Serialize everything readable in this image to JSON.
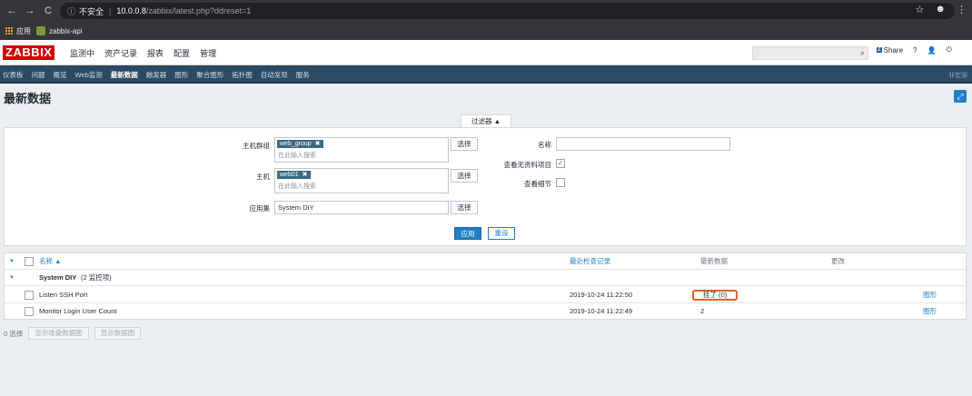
{
  "browser": {
    "nav": {
      "back": "←",
      "forward": "→",
      "reload": "C",
      "info": "ⓘ"
    },
    "security": "不安全",
    "url_host": "10.0.0.8",
    "url_path": "/zabbix/latest.php?ddreset=1",
    "bookmarks": [
      "应用",
      "zabbix-api"
    ]
  },
  "header": {
    "logo": "ZABBIX",
    "menu": [
      "监测中",
      "资产记录",
      "报表",
      "配置",
      "管理"
    ],
    "share": "Share",
    "share_badge": "Z",
    "help": "?",
    "user": "👤",
    "power": "⏻"
  },
  "submenu": {
    "items": [
      "仪表板",
      "问题",
      "概览",
      "Web监测",
      "最新数据",
      "触发器",
      "图形",
      "聚合图形",
      "拓扑图",
      "自动发现",
      "服务"
    ],
    "active_index": 4,
    "right": "非宏源"
  },
  "page": {
    "title": "最新数据"
  },
  "filter": {
    "tab_label": "过滤器 ▲",
    "host_group_label": "主机群组",
    "host_group_tag": "web_group",
    "host_label": "主机",
    "host_tag": "web01",
    "search_placeholder": "在此输入搜索",
    "application_label": "应用集",
    "application_value": "System DIY",
    "select_label": "选择",
    "name_label": "名称",
    "name_value": "",
    "show_no_data_label": "查看无资料项目",
    "show_no_data_checked": true,
    "show_details_label": "查看细节",
    "show_details_checked": false,
    "apply_label": "应用",
    "reset_label": "重设"
  },
  "table": {
    "headers": {
      "name": "名称 ▲",
      "last_check": "最近检查记录",
      "last_value": "最新数据",
      "change": "更改"
    },
    "group": {
      "name": "System DIY",
      "count": "(2 监控项)"
    },
    "rows": [
      {
        "name": "Listen SSH Port",
        "last_check": "2019-10-24 11:22:50",
        "last_value": "挂了 (0)",
        "action": "图形"
      },
      {
        "name": "Monitor Login User Count",
        "last_check": "2019-10-24 11:22:49",
        "last_value": "2",
        "action": "图形"
      }
    ]
  },
  "footer": {
    "selected": "0 选择",
    "btn_stacked": "显示堆叠数据图",
    "btn_graph": "显示数据图"
  }
}
